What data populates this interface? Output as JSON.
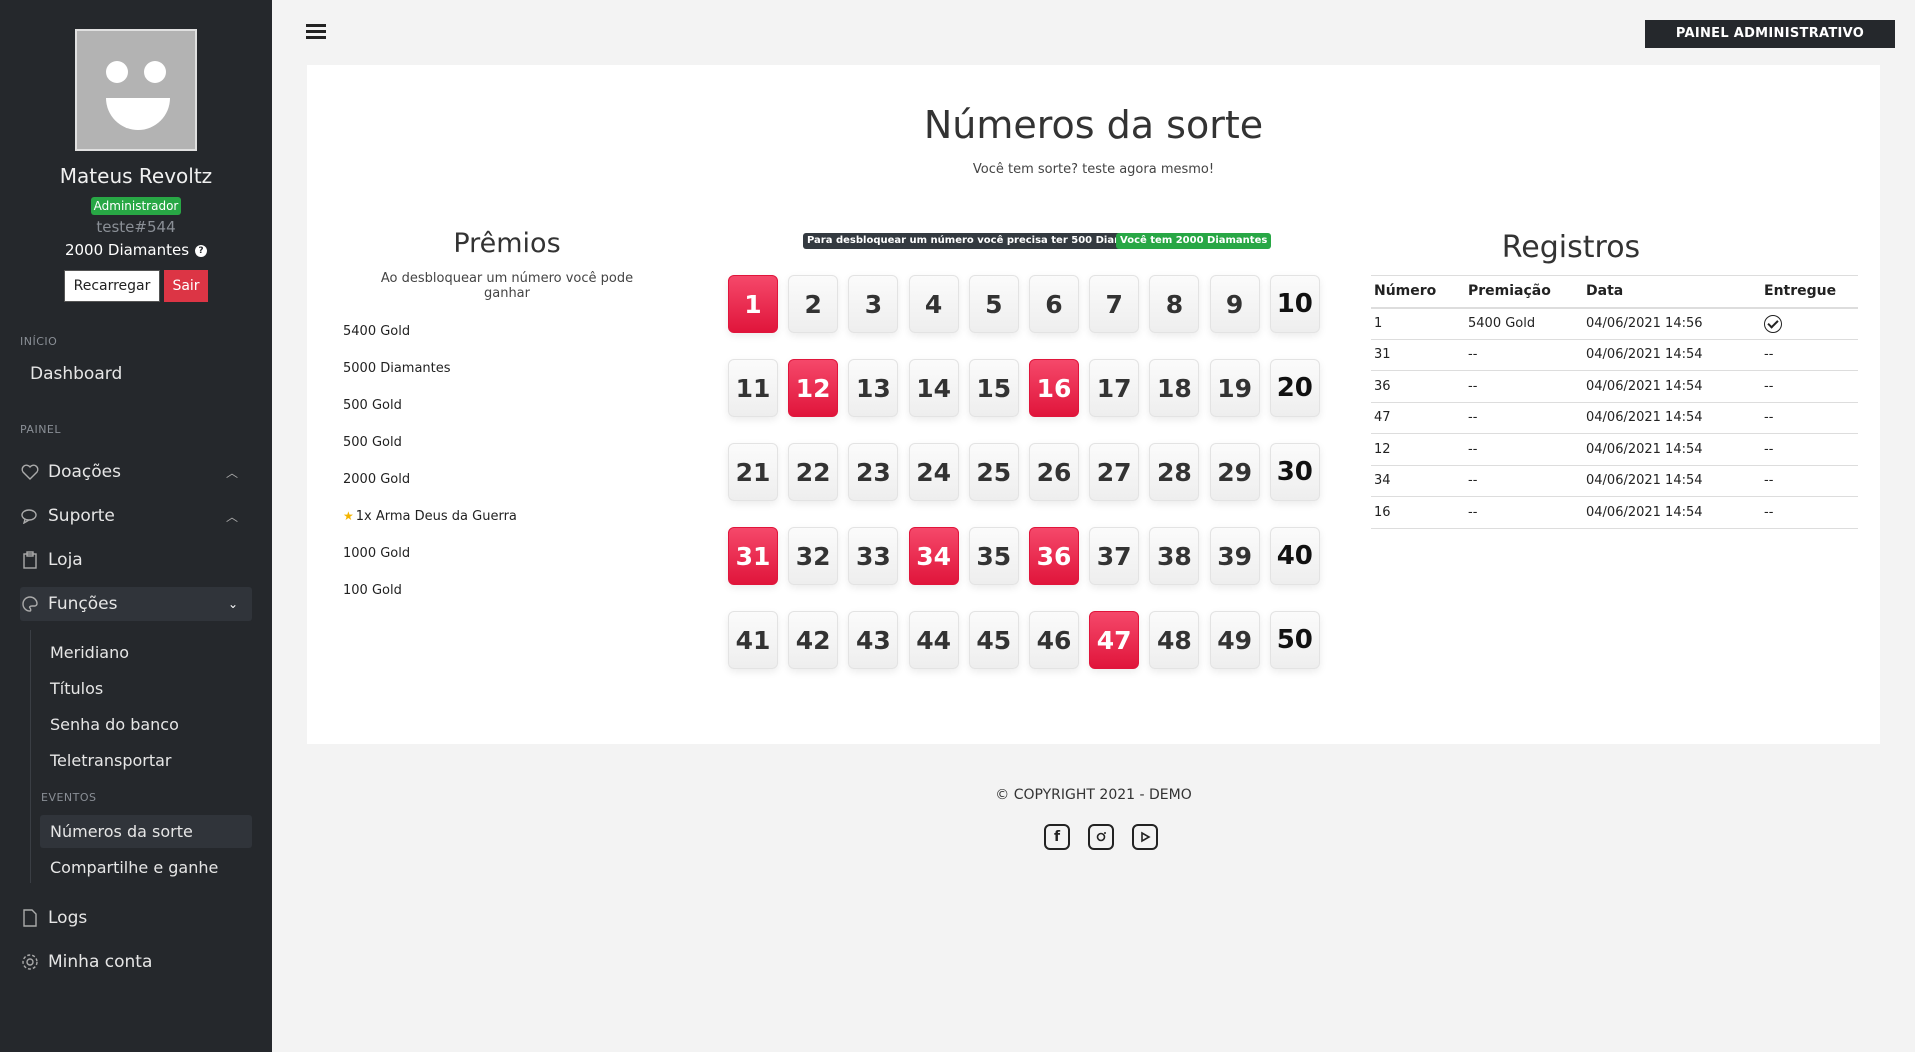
{
  "sidebar": {
    "user": {
      "name": "Mateus Revoltz",
      "role": "Administrador",
      "tag": "teste#544",
      "diamonds": "2000 Diamantes"
    },
    "buttons": {
      "recharge": "Recarregar",
      "logout": "Sair"
    },
    "sections": {
      "start": "INÍCIO",
      "panel": "PAINEL",
      "events": "EVENTOS"
    },
    "items": {
      "dashboard": "Dashboard",
      "donations": "Doações",
      "support": "Suporte",
      "shop": "Loja",
      "functions": "Funções",
      "logs": "Logs",
      "account": "Minha conta"
    },
    "functions_sub": [
      "Meridiano",
      "Títulos",
      "Senha do banco",
      "Teletransportar"
    ],
    "events_sub": [
      "Números da sorte",
      "Compartilhe e ganhe"
    ]
  },
  "topbar": {
    "admin_button": "PAINEL ADMINISTRATIVO"
  },
  "main": {
    "title": "Números da sorte",
    "subtitle": "Você tem sorte? teste agora mesmo!",
    "badge_cost": "Para desbloquear um número você precisa ter 500 Diamantes",
    "badge_have": "Você tem 2000 Diamantes",
    "prizes": {
      "title": "Prêmios",
      "description": "Ao desbloquear um número você pode ganhar",
      "list": [
        "5400 Gold",
        "5000 Diamantes",
        "500 Gold",
        "500 Gold",
        "2000 Gold",
        "1x Arma Deus da Guerra",
        "1000 Gold",
        "100 Gold"
      ]
    },
    "grid": {
      "numbers": [
        1,
        2,
        3,
        4,
        5,
        6,
        7,
        8,
        9,
        10,
        11,
        12,
        13,
        14,
        15,
        16,
        17,
        18,
        19,
        20,
        21,
        22,
        23,
        24,
        25,
        26,
        27,
        28,
        29,
        30,
        31,
        32,
        33,
        34,
        35,
        36,
        37,
        38,
        39,
        40,
        41,
        42,
        43,
        44,
        45,
        46,
        47,
        48,
        49,
        50
      ],
      "unlocked": [
        1,
        12,
        16,
        31,
        34,
        36,
        47
      ]
    },
    "records": {
      "title": "Registros",
      "headers": [
        "Número",
        "Premiação",
        "Data",
        "Entregue"
      ],
      "rows": [
        [
          "1",
          "5400 Gold",
          "04/06/2021 14:56",
          "check"
        ],
        [
          "31",
          "--",
          "04/06/2021 14:54",
          "--"
        ],
        [
          "36",
          "--",
          "04/06/2021 14:54",
          "--"
        ],
        [
          "47",
          "--",
          "04/06/2021 14:54",
          "--"
        ],
        [
          "12",
          "--",
          "04/06/2021 14:54",
          "--"
        ],
        [
          "34",
          "--",
          "04/06/2021 14:54",
          "--"
        ],
        [
          "16",
          "--",
          "04/06/2021 14:54",
          "--"
        ]
      ]
    }
  },
  "footer": {
    "copyright": "© COPYRIGHT 2021 - DEMO",
    "social_icons": [
      "facebook-icon",
      "instagram-icon",
      "youtube-icon"
    ]
  },
  "colors": {
    "sidebar": "#25282c",
    "unlocked": "#e0153b",
    "success": "#28a745",
    "danger": "#dc3545"
  }
}
